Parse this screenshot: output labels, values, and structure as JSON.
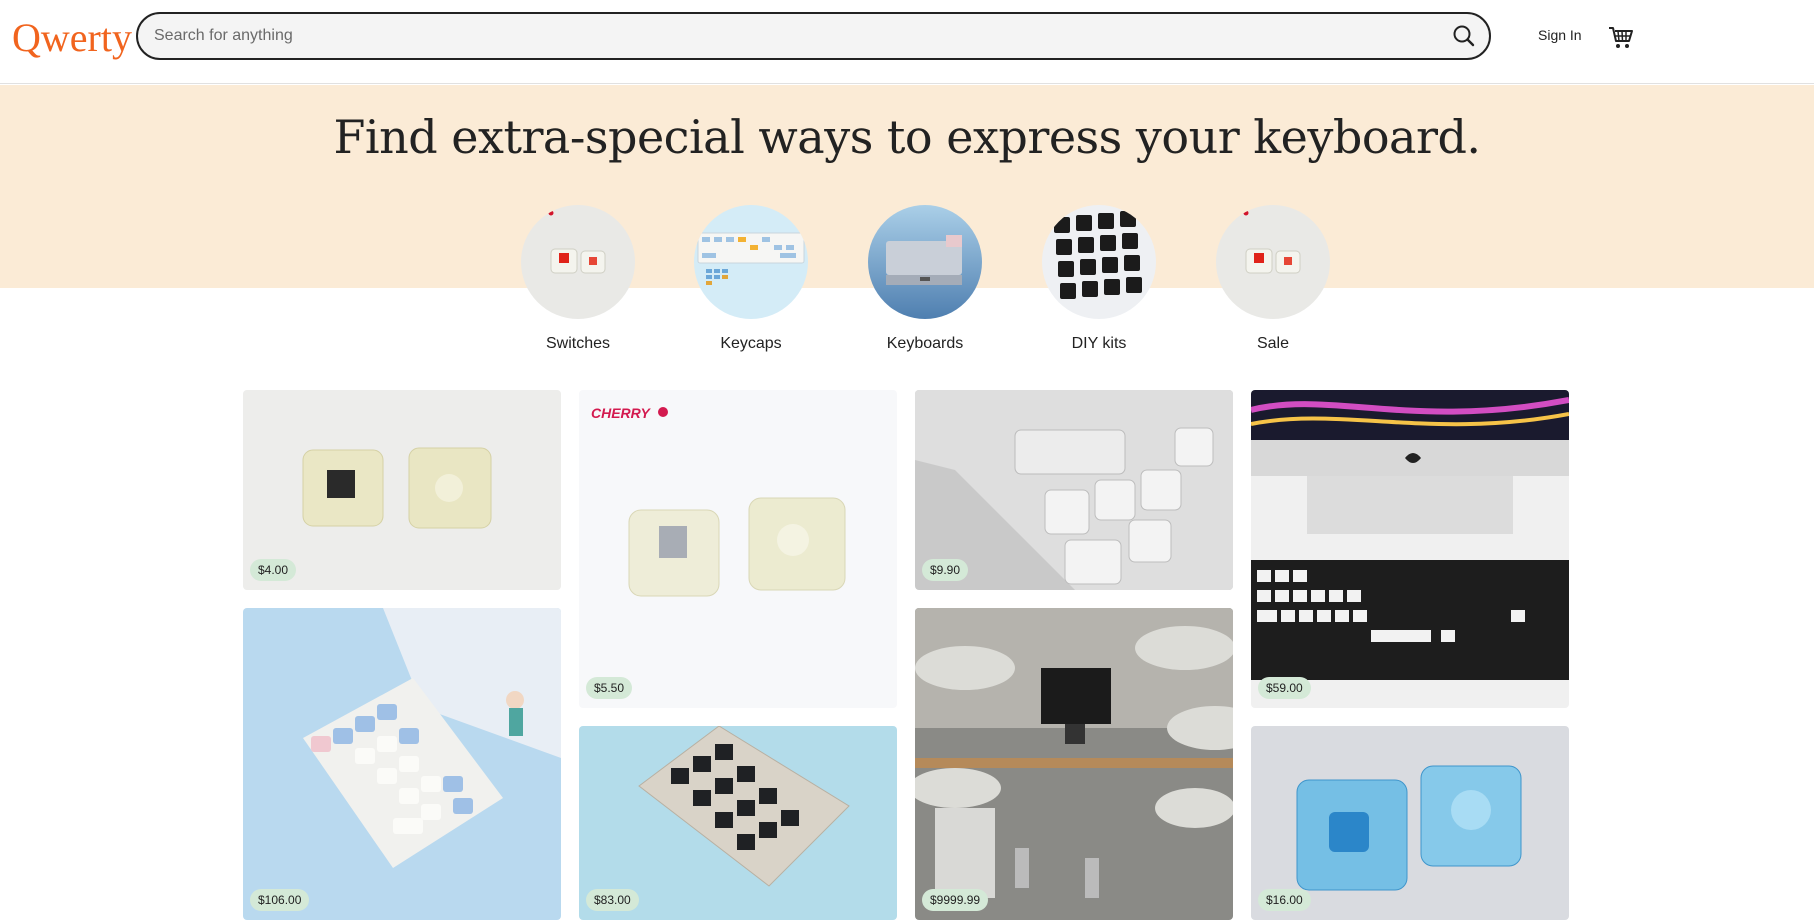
{
  "header": {
    "logo": "Qwerty",
    "search_placeholder": "Search for anything",
    "signin_label": "Sign In"
  },
  "hero": {
    "title": "Find extra-special ways to express your keyboard."
  },
  "categories": [
    {
      "label": "Switches"
    },
    {
      "label": "Keycaps"
    },
    {
      "label": "Keyboards"
    },
    {
      "label": "DIY kits"
    },
    {
      "label": "Sale"
    }
  ],
  "products": [
    {
      "price": "$4.00"
    },
    {
      "price": "$5.50"
    },
    {
      "price": "$9.90"
    },
    {
      "price": "$59.00"
    },
    {
      "price": "$106.00"
    },
    {
      "price": "$83.00"
    },
    {
      "price": "$9999.99"
    },
    {
      "price": "$16.00"
    }
  ],
  "brand_mark": "CHERRY",
  "colors": {
    "logo": "#f1641e",
    "hero_bg": "#fbebd6",
    "price_badge": "#d4e9d7"
  },
  "icons": [
    "search-icon",
    "cart-icon"
  ]
}
